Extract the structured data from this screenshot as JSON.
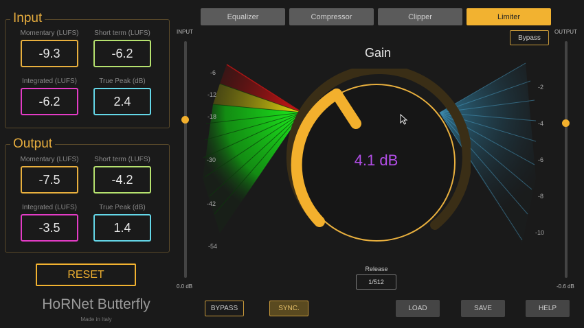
{
  "tabs": [
    {
      "label": "Equalizer",
      "active": false
    },
    {
      "label": "Compressor",
      "active": false
    },
    {
      "label": "Clipper",
      "active": false
    },
    {
      "label": "Limiter",
      "active": true
    }
  ],
  "input_group": {
    "title": "Input",
    "meters": [
      {
        "label": "Momentary (LUFS)",
        "value": "-9.3",
        "color": "#e9b03e"
      },
      {
        "label": "Short term (LUFS)",
        "value": "-6.2",
        "color": "#b6e26f"
      },
      {
        "label": "Integrated (LUFS)",
        "value": "-6.2",
        "color": "#e43cc6"
      },
      {
        "label": "True Peak (dB)",
        "value": "2.4",
        "color": "#64d7e8"
      }
    ]
  },
  "output_group": {
    "title": "Output",
    "meters": [
      {
        "label": "Momentary (LUFS)",
        "value": "-7.5",
        "color": "#e9b03e"
      },
      {
        "label": "Short term (LUFS)",
        "value": "-4.2",
        "color": "#b6e26f"
      },
      {
        "label": "Integrated (LUFS)",
        "value": "-3.5",
        "color": "#e43cc6"
      },
      {
        "label": "True Peak (dB)",
        "value": "1.4",
        "color": "#64d7e8"
      }
    ]
  },
  "reset_label": "RESET",
  "brand": {
    "name": "HoRNet Butterfly",
    "subtitle": "Made in Italy"
  },
  "input_slider": {
    "label": "INPUT",
    "value": "0.0 dB"
  },
  "output_slider": {
    "label": "OUTPUT",
    "value": "-0.6 dB"
  },
  "bypass_top": "Bypass",
  "gain": {
    "title": "Gain",
    "value": "4.1 dB"
  },
  "release": {
    "label": "Release",
    "value": "1/512"
  },
  "left_scale": [
    "-6",
    "-12",
    "-18",
    "-30",
    "-42",
    "-54"
  ],
  "right_scale": [
    "-2",
    "-4",
    "-6",
    "-8",
    "-10"
  ],
  "bottom_buttons": {
    "bypass": "BYPASS",
    "sync": "SYNC.",
    "load": "LOAD",
    "save": "SAVE",
    "help": "HELP"
  },
  "icons": {
    "pointer": "mouse-pointer-icon"
  }
}
